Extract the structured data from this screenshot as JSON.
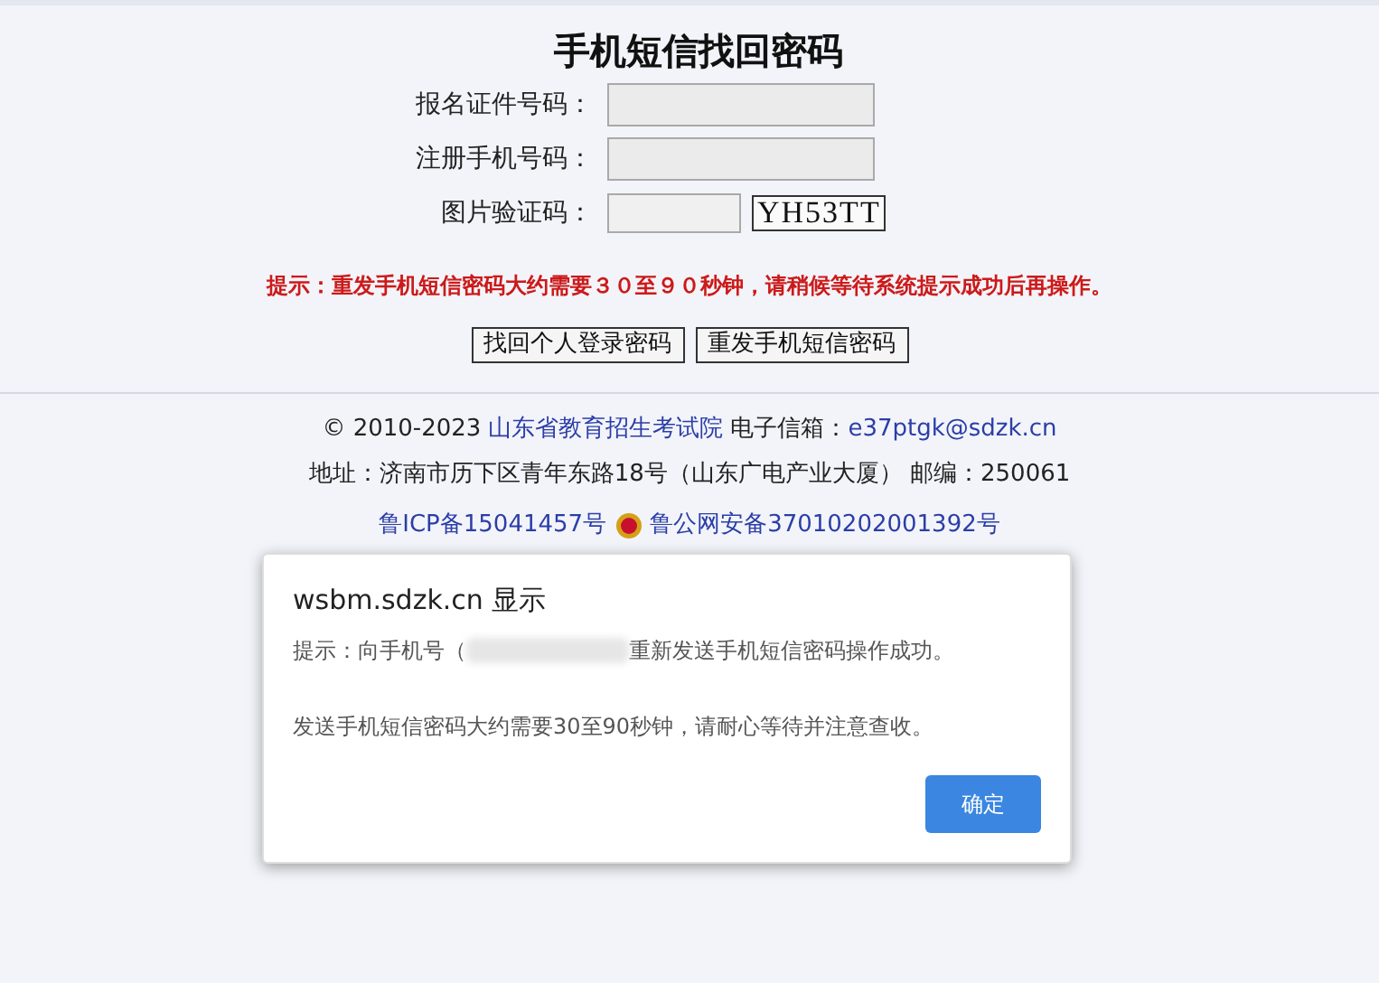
{
  "page_title": "手机短信找回密码",
  "form_fields": [
    {
      "label": "报名证件号码：",
      "kind": "text"
    },
    {
      "label": "注册手机号码：",
      "kind": "text"
    },
    {
      "label": "图片验证码：",
      "kind": "captcha",
      "captcha": "YH53TT"
    }
  ],
  "hint": "提示：重发手机短信密码大约需要３０至９０秒钟，请稍候等待系统提示成功后再操作。",
  "buttons": [
    "找回个人登录密码",
    "重发手机短信密码"
  ],
  "footer": {
    "copyright": "© 2010-2023",
    "org_link": "山东省教育招生考试院",
    "email_label": "电子信箱：",
    "email": "e37ptgk@sdzk.cn",
    "address": "地址：济南市历下区青年东路18号（山东广电产业大厦） 邮编：250061",
    "icp": "鲁ICP备15041457号",
    "police": "鲁公网安备37010202001392号"
  },
  "dialog": {
    "title": "wsbm.sdzk.cn 显示",
    "message_start": "提示：向手机号（",
    "message_end": "重新发送手机短信密码操作成功。",
    "note": "发送手机短信密码大约需要30至90秒钟，请耐心等待并注意查收。",
    "ok": "确定"
  }
}
